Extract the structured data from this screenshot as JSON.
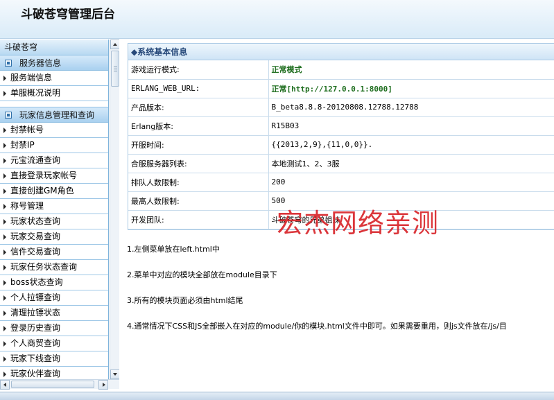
{
  "header": {
    "title": "斗破苍穹管理后台"
  },
  "sidebar": {
    "title": "斗破苍穹",
    "groups": [
      {
        "label": "服务器信息",
        "items": [
          "服务端信息",
          "单服概况说明"
        ]
      },
      {
        "label": "玩家信息管理和查询",
        "items": [
          "封禁帐号",
          "封禁IP",
          "元宝流通查询",
          "直接登录玩家帐号",
          "直接创建GM角色",
          "称号管理",
          "玩家状态查询",
          "玩家交易查询",
          "信件交易查询",
          "玩家任务状态查询",
          "boss状态查询",
          "个人拉镖查询",
          "清理拉镖状态",
          "登录历史查询",
          "个人商贸查询",
          "玩家下线查询",
          "玩家伙伴查询"
        ]
      }
    ]
  },
  "main": {
    "panel_title": "系统基本信息",
    "rows": [
      {
        "label": "游戏运行模式:",
        "value": "正常模式"
      },
      {
        "label": "ERLANG_WEB_URL:",
        "value": "正常[http://127.0.0.1:8000]"
      },
      {
        "label": "产品版本:",
        "value": "B_beta8.8.8-20120808.12788.12788"
      },
      {
        "label": "Erlang版本:",
        "value": "R15B03"
      },
      {
        "label": "开服时间:",
        "value": "{{2013,2,9},{11,0,0}}."
      },
      {
        "label": "合服服务器列表:",
        "value": "本地测试1、2、3服"
      },
      {
        "label": "排队人数限制:",
        "value": "200"
      },
      {
        "label": "最高人数限制:",
        "value": "500"
      },
      {
        "label": "开发团队:",
        "value": "斗破苍穹的兄弟姐妹"
      }
    ],
    "notes": [
      "1.左侧菜单放在left.html中",
      "2.菜单中对应的模块全部放在module目录下",
      "3.所有的模块页面必须由html结尾",
      "4.通常情况下CSS和JS全部嵌入在对应的module/你的模块.html文件中即可。如果需要重用，则js文件放在/js/目"
    ],
    "watermark": "宏杰网络亲测"
  },
  "colors": {
    "accent_green": "#1f6e1f",
    "panel_title": "#27497a",
    "watermark": "#d9262b"
  }
}
